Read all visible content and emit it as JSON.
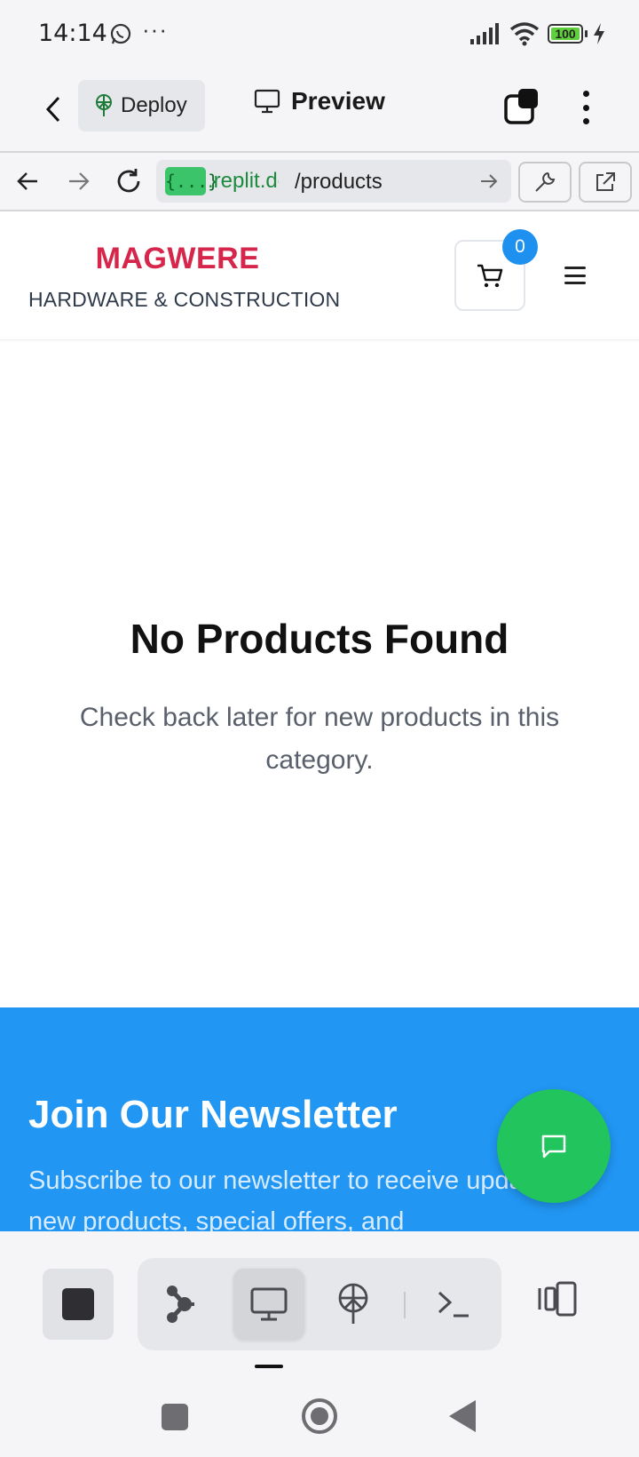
{
  "status_bar": {
    "time": "14:14",
    "overflow": "···",
    "battery_level": "100",
    "icons": [
      "whatsapp-icon",
      "signal-icon",
      "wifi-icon",
      "battery-icon",
      "charging-bolt-icon"
    ]
  },
  "replit_header": {
    "deploy_label": "Deploy",
    "preview_label": "Preview"
  },
  "url_bar": {
    "badge": "{...}",
    "domain": ".replit.dev",
    "path": "/products"
  },
  "site": {
    "brand_name": "MAGWERE",
    "brand_tagline": "HARDWARE & CONSTRUCTION",
    "cart_count": "0",
    "brand_color": "#d6264b",
    "accent_color": "#2196f3"
  },
  "empty_state": {
    "title": "No Products Found",
    "description": "Check back later for new products in this category."
  },
  "newsletter": {
    "title": "Join Our Newsletter",
    "text": "Subscribe to our newsletter to receive updates on new products, special offers, and"
  },
  "bottom_toolbar": {
    "tools": [
      "stop-icon",
      "agent-icon",
      "preview-icon",
      "deploy-icon",
      "shell-icon",
      "layout-icon"
    ],
    "active_tool": "preview-icon"
  }
}
